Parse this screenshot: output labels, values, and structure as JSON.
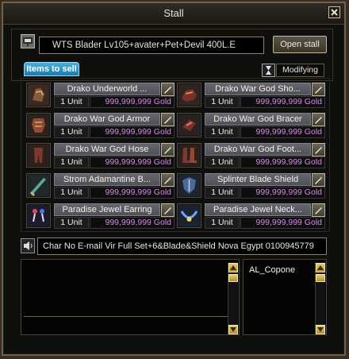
{
  "window": {
    "title": "Stall"
  },
  "stall": {
    "title_value": "WTS Blader Lv105+avater+Pet+Devil 400L.E",
    "open_button": "Open stall"
  },
  "tab": {
    "items_label": "Items to sell"
  },
  "modify": {
    "label": "Modifying"
  },
  "items": [
    {
      "name": "Drako Underworld ...",
      "unit": "1 Unit",
      "price": "999,999,999 Gold",
      "icon": "armor-gloves-icon"
    },
    {
      "name": "Drako War God Sho...",
      "unit": "1 Unit",
      "price": "999,999,999 Gold",
      "icon": "shoulder-armor-icon"
    },
    {
      "name": "Drako War God Armor",
      "unit": "1 Unit",
      "price": "999,999,999 Gold",
      "icon": "body-armor-icon"
    },
    {
      "name": "Drako War God Bracer",
      "unit": "1 Unit",
      "price": "999,999,999 Gold",
      "icon": "bracer-icon"
    },
    {
      "name": "Drako War God Hose",
      "unit": "1 Unit",
      "price": "999,999,999 Gold",
      "icon": "hose-icon"
    },
    {
      "name": "Drako War God Foot...",
      "unit": "1 Unit",
      "price": "999,999,999 Gold",
      "icon": "boots-icon"
    },
    {
      "name": "Strom Adamantine B...",
      "unit": "1 Unit",
      "price": "999,999,999 Gold",
      "icon": "blade-icon"
    },
    {
      "name": "Splinter Blade Shield",
      "unit": "1 Unit",
      "price": "999,999,999 Gold",
      "icon": "shield-icon"
    },
    {
      "name": "Paradise Jewel Earring",
      "unit": "1 Unit",
      "price": "999,999,999 Gold",
      "icon": "earring-icon"
    },
    {
      "name": "Paradise Jewel Neck...",
      "unit": "1 Unit",
      "price": "999,999,999 Gold",
      "icon": "necklace-icon"
    }
  ],
  "announcement": {
    "text": "Char No E-mail Vir Full Set+6&Blade&Shield Nova Egypt 0100945779"
  },
  "visitors": [
    "AL_Copone"
  ],
  "colors": {
    "price": "#d38ce3",
    "tab_accent": "#2f9fd3",
    "button_border": "#c8b995"
  }
}
